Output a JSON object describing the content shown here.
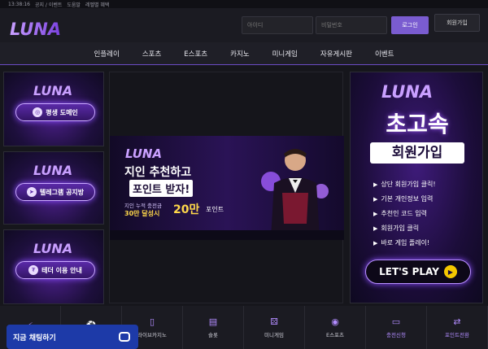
{
  "topbar": {
    "time": "13:38:16",
    "links": [
      "공지 / 이벤트",
      "도움말",
      "레벨별 혜택"
    ]
  },
  "header": {
    "logo_text": "LUNA",
    "id_placeholder": "아이디",
    "pw_placeholder": "비밀번호",
    "login_label": "로그인",
    "join_label": "회원가입"
  },
  "nav": [
    "인플레이",
    "스포츠",
    "E스포츠",
    "카지노",
    "미니게임",
    "자유게시판",
    "이벤트"
  ],
  "left_banners": [
    {
      "logo": "LUNA",
      "label": "평생 도메인"
    },
    {
      "logo": "LUNA",
      "label": "텔레그램 공지방"
    },
    {
      "logo": "LUNA",
      "label": "테더 이용 안내"
    }
  ],
  "center_banner": {
    "logo": "LUNA",
    "headline1": "지인 추천하고",
    "headline2": "포인트 받자!",
    "sub1": "지인 누적 충전금",
    "sub2": "30만 달성시",
    "amount": "20만",
    "amount_unit": "포인트"
  },
  "right_banner": {
    "logo": "LUNA",
    "title": "초고속",
    "subtitle": "회원가입",
    "steps": [
      "상단 회원가입 클릭!",
      "기본 개인정보 입력",
      "추천인 코드 입력",
      "회원가입 클릭",
      "바로 게임 플레이!"
    ],
    "cta": "LET'S PLAY"
  },
  "bottom_bar": [
    {
      "icon": "lightning-icon",
      "label": ""
    },
    {
      "icon": "soccer-ball-icon",
      "label": ""
    },
    {
      "icon": "phone-icon",
      "label": "라이브카지노"
    },
    {
      "icon": "slot-machine-icon",
      "label": "슬롯"
    },
    {
      "icon": "dice-icon",
      "label": "미니게임"
    },
    {
      "icon": "gamepad-icon",
      "label": "E스포츠"
    },
    {
      "icon": "credit-card-icon",
      "label": "충전신청"
    },
    {
      "icon": "exchange-icon",
      "label": "포인트전환"
    }
  ],
  "chat": {
    "label": "지금 채팅하기"
  }
}
